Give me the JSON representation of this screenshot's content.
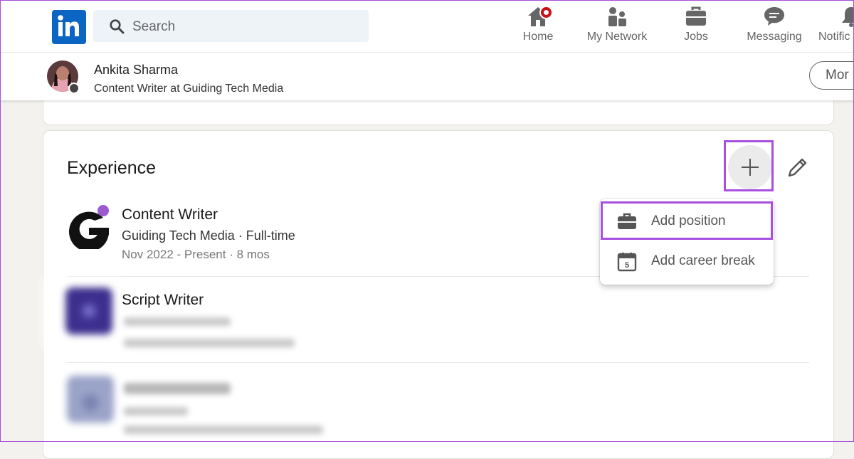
{
  "nav": {
    "search_placeholder": "Search",
    "items": [
      {
        "label": "Home",
        "icon": "home-icon"
      },
      {
        "label": "My Network",
        "icon": "people-icon"
      },
      {
        "label": "Jobs",
        "icon": "briefcase-icon"
      },
      {
        "label": "Messaging",
        "icon": "chat-icon"
      },
      {
        "label": "Notific",
        "icon": "bell-icon"
      }
    ]
  },
  "profile": {
    "name": "Ankita Sharma",
    "headline": "Content Writer at Guiding Tech Media",
    "more_label": "Mor"
  },
  "experience": {
    "title": "Experience",
    "add_menu": [
      {
        "label": "Add position",
        "icon": "briefcase-icon"
      },
      {
        "label": "Add career break",
        "icon": "calendar-icon",
        "icon_text": "5"
      }
    ],
    "positions": [
      {
        "title": "Content Writer",
        "company": "Guiding Tech Media · Full-time",
        "dates": "Nov 2022 - Present · 8 mos"
      },
      {
        "title": "Script Writer"
      }
    ]
  },
  "colors": {
    "linkedin_blue": "#0a66c2",
    "highlight_purple": "#a94fe0",
    "notification_red": "#cc1016"
  }
}
